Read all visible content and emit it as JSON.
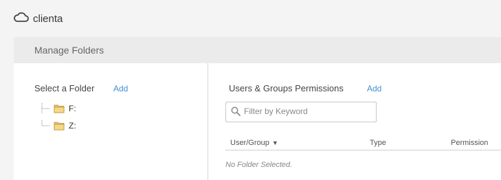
{
  "app": {
    "title": "clienta",
    "icon": "cloud-icon"
  },
  "panel": {
    "title": "Manage Folders"
  },
  "folders": {
    "label": "Select a Folder",
    "add_label": "Add",
    "items": [
      {
        "label": "F:",
        "icon": "folder-icon"
      },
      {
        "label": "Z:",
        "icon": "folder-icon"
      }
    ]
  },
  "permissions": {
    "label": "Users & Groups Permissions",
    "add_label": "Add",
    "filter_placeholder": "Filter by Keyword",
    "columns": [
      "User/Group",
      "Type",
      "Permission"
    ],
    "sort_indicator": "▼",
    "empty_message": "No Folder Selected."
  },
  "colors": {
    "accent": "#3d8fd6",
    "header_bg": "#ebebeb"
  }
}
